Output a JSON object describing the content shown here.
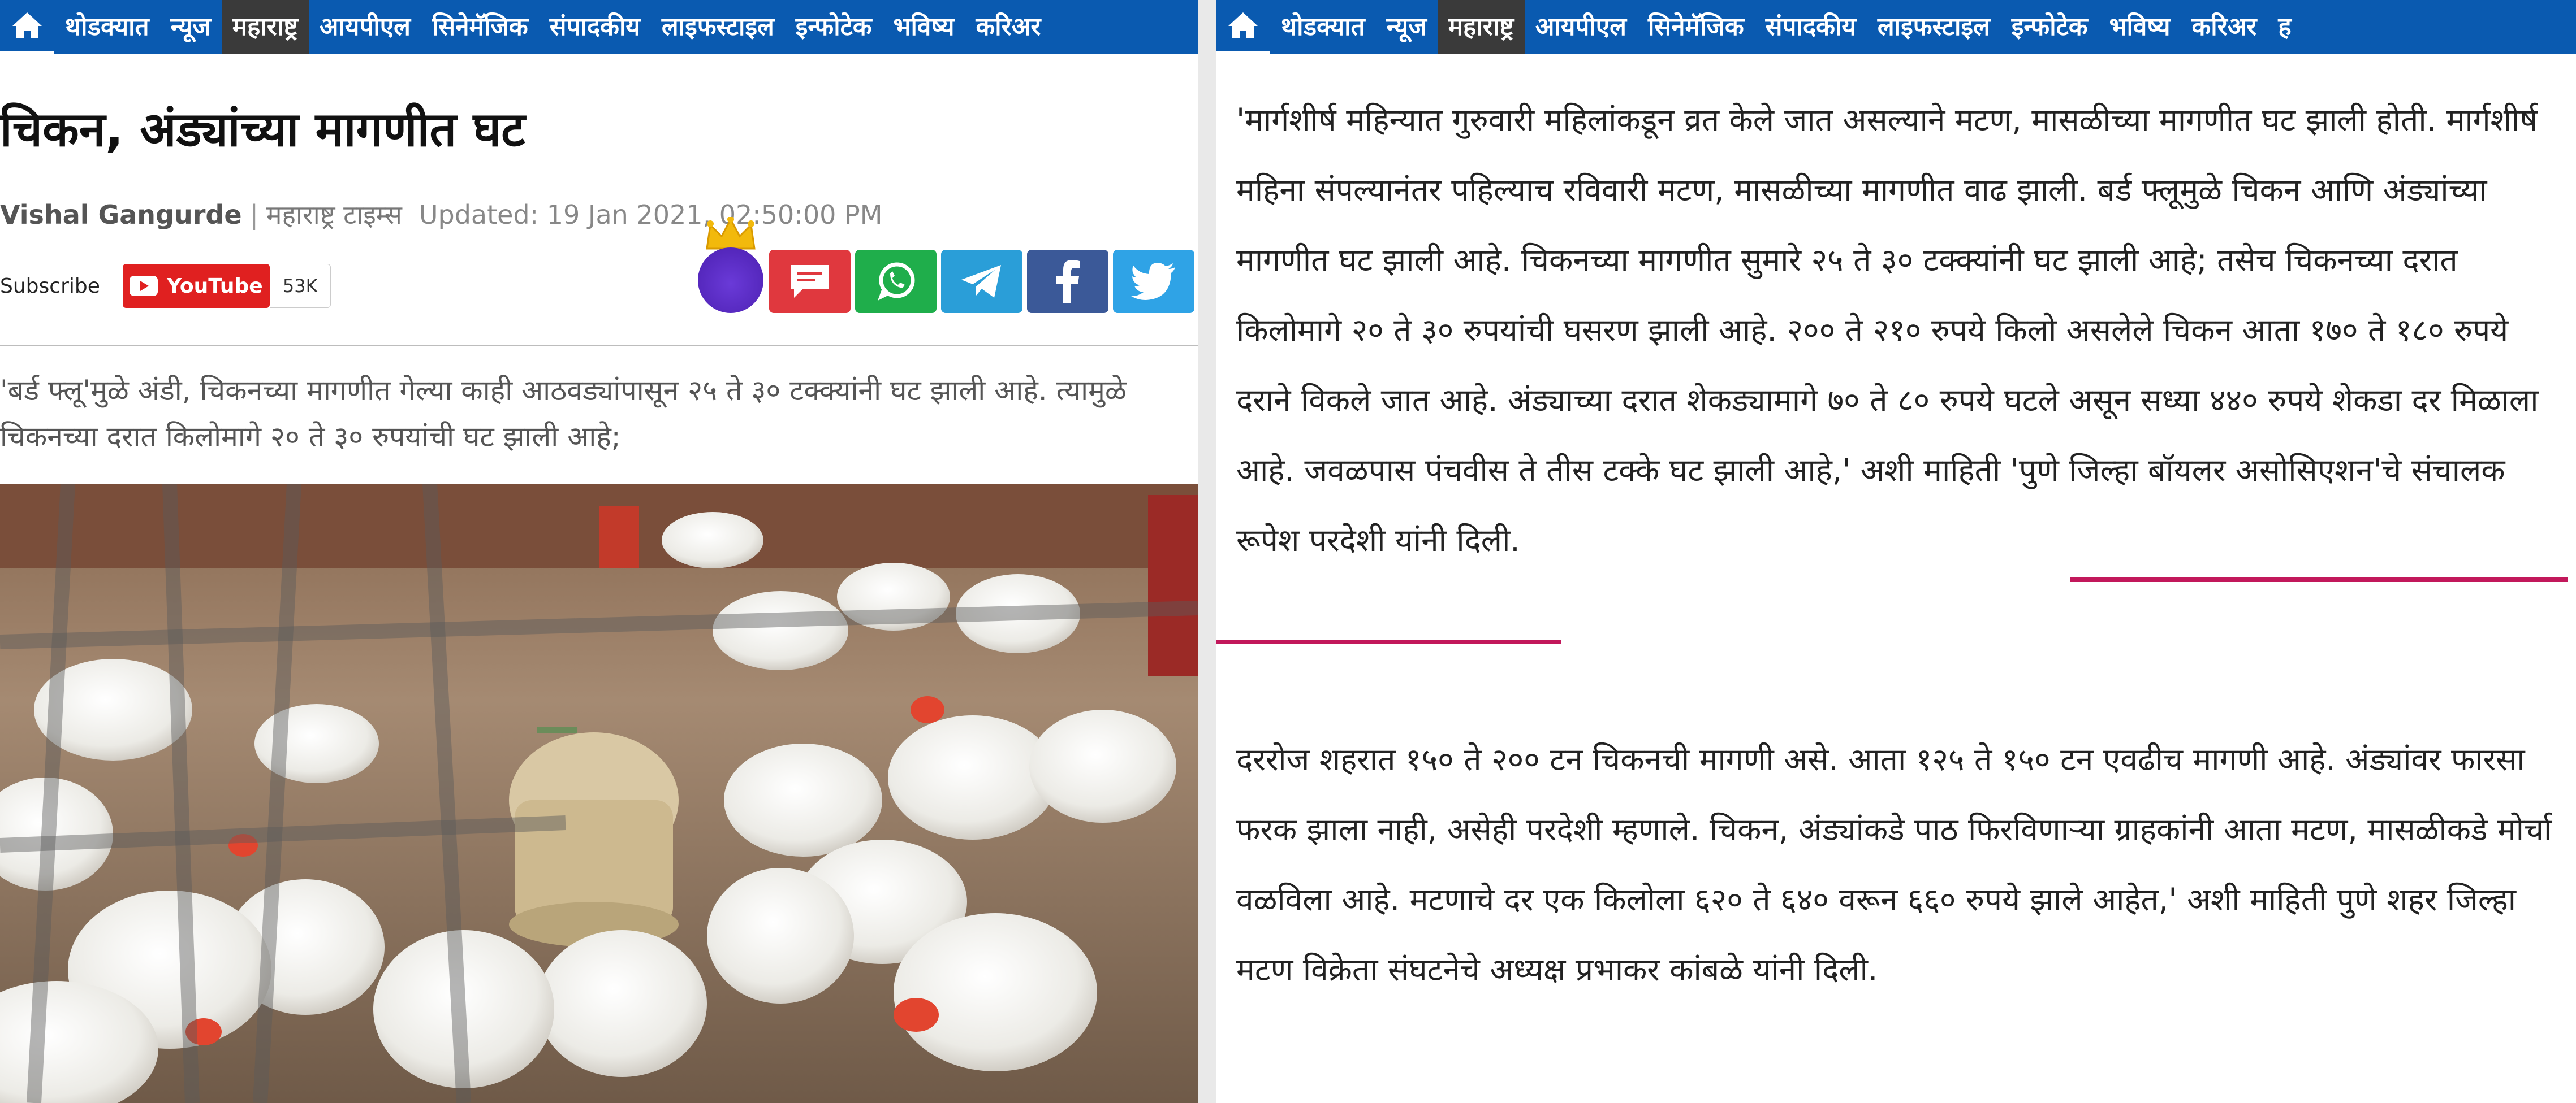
{
  "nav": {
    "home_icon": "home-icon",
    "items": [
      "थोडक्यात",
      "न्यूज",
      "महाराष्ट्र",
      "आयपीएल",
      "सिनेमॅजिक",
      "संपादकीय",
      "लाइफस्टाइल",
      "इन्फोटेक",
      "भविष्य",
      "करिअर",
      "ह"
    ],
    "active_index": 2
  },
  "article": {
    "headline": "चिकन, अंड्यांच्या मागणीत घट",
    "author": "Vishal Gangurde",
    "separator": "|",
    "source": "महाराष्ट्र टाइम्स",
    "updated": "Updated: 19 Jan 2021, 02:50:00 PM",
    "summary": "'बर्ड फ्लू'मुळे अंडी, चिकनच्या मागणीत गेल्या काही आठवड्यांपासून २५ ते ३० टक्क्यांनी घट झाली आहे. त्यामुळे चिकनच्या दरात किलोमागे २० ते ३० रुपयांची घट झाली आहे;"
  },
  "subscribe": {
    "label": "Subscribe",
    "youtube_label": "YouTube",
    "count": "53K"
  },
  "share": {
    "icons": [
      "crown-icon",
      "comment-icon",
      "whatsapp-icon",
      "telegram-icon",
      "facebook-icon",
      "twitter-icon"
    ],
    "colors": {
      "comment": "#e0383e",
      "whatsapp": "#1fae4b",
      "telegram": "#2a9ed8",
      "facebook": "#3b5998",
      "twitter": "#2fa3e6"
    }
  },
  "body": {
    "para1": "'मार्गशीर्ष महिन्यात गुरुवारी महिलांकडून व्रत केले जात असल्याने मटण, मासळीच्या मागणीत घट झाली होती. मार्गशीर्ष महिना संपल्यानंतर पहिल्याच रविवारी मटण, मासळीच्या मागणीत वाढ झाली. बर्ड फ्लूमुळे चिकन आणि अंड्यांच्या मागणीत घट झाली आहे. चिकनच्या मागणीत सुमारे २५ ते ३० टक्क्यांनी घट झाली आहे; तसेच चिकनच्या दरात किलोमागे २० ते ३० रुपयांची घसरण झाली आहे. २०० ते २१० रुपये किलो असलेले चिकन आता १७० ते १८० रुपये दराने विकले जात आहे. अंड्याच्या दरात शेकड्यामागे ७० ते ८० रुपये घटले असून सध्या ४४० रुपये शेकडा दर मिळाला आहे. जवळपास पंचवीस ते तीस टक्के घट झाली आहे,' अशी माहिती 'पुणे जिल्हा बॉयलर असोसिएशन'चे संचालक रूपेश परदेशी यांनी दिली.",
    "para2": "दररोज शहरात १५० ते २०० टन चिकनची मागणी असे. आता १२५ ते १५० टन एवढीच मागणी आहे. अंड्यांवर फारसा फरक झाला नाही, असेही परदेशी म्हणाले. चिकन, अंड्यांकडे पाठ फिरविणाऱ्या ग्राहकांनी आता मटण, मासळीकडे मोर्चा वळविला आहे. मटणाचे दर एक किलोला ६२० ते ६४० वरून ६६० रुपये झाले आहेत,' अशी माहिती पुणे शहर जिल्हा मटण विक्रेता संघटनेचे अध्यक्ष प्रभाकर कांबळे यांनी दिली."
  },
  "colors": {
    "nav_bg": "#0a5ab0",
    "nav_active_bg": "#3a3a3a",
    "youtube_red": "#e02020",
    "highlight_underline": "#c2185b"
  }
}
